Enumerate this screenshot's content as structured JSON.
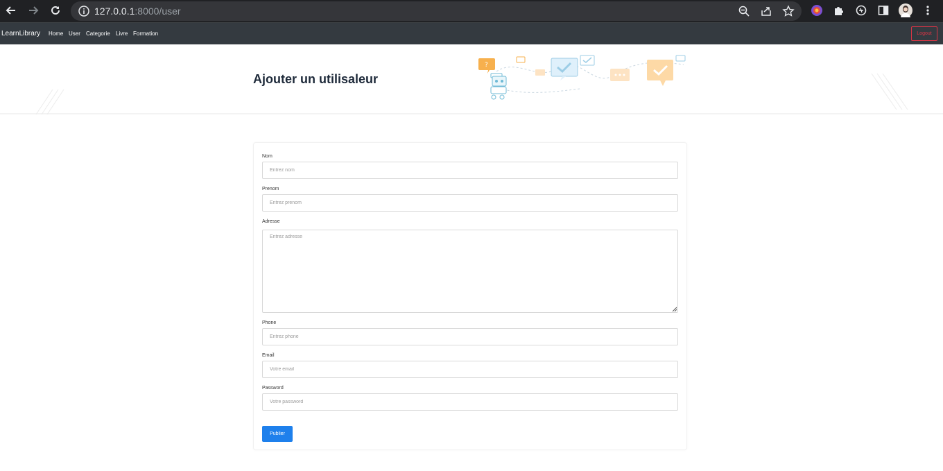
{
  "browser": {
    "url_host": "127.0.0.1",
    "url_rest": ":8000/user"
  },
  "navbar": {
    "brand": "LearnLibrary",
    "links": [
      "Home",
      "User",
      "Categorie",
      "Livre",
      "Formation"
    ],
    "logout_label": "Logout"
  },
  "hero": {
    "title": "Ajouter un utilisaleur"
  },
  "form": {
    "fields": [
      {
        "label": "Nom",
        "placeholder": "Entrez nom"
      },
      {
        "label": "Prenom",
        "placeholder": "Entrez prenom"
      },
      {
        "label": "Adresse",
        "placeholder": "Entrez adresse"
      },
      {
        "label": "Phone",
        "placeholder": "Entrez phone"
      },
      {
        "label": "Email",
        "placeholder": "Votre email"
      },
      {
        "label": "Password",
        "placeholder": "Votre password"
      }
    ],
    "submit_label": "Publier"
  },
  "colors": {
    "navbar_bg": "#343a40",
    "logout": "#dc3545",
    "submit": "#1e80ec",
    "title": "#1e2a3a"
  }
}
